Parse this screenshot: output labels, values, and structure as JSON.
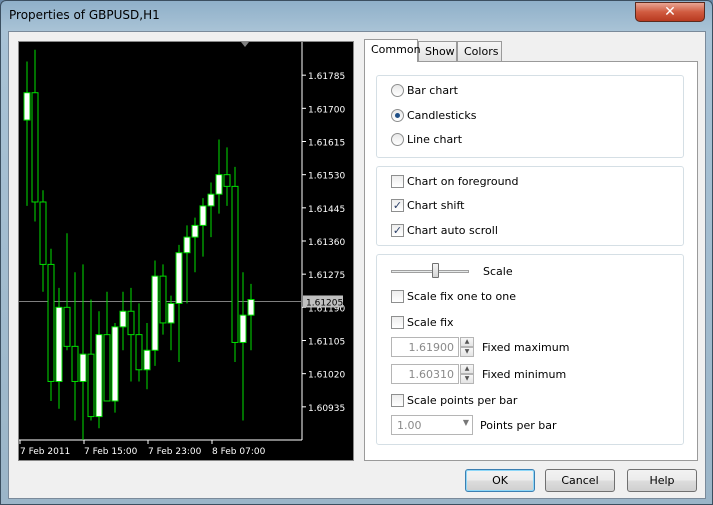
{
  "window": {
    "title": "Properties of GBPUSD,H1",
    "close_glyph": "✕"
  },
  "chart": {
    "price_labels": [
      "1.61785",
      "1.61700",
      "1.61615",
      "1.61530",
      "1.61445",
      "1.61360",
      "1.61275",
      "1.61190",
      "1.61105",
      "1.61020",
      "1.60935"
    ],
    "current_price": "1.61205",
    "time_labels": [
      "7 Feb 2011",
      "7 Feb 15:00",
      "7 Feb 23:00",
      "8 Feb 07:00"
    ],
    "candles": [
      {
        "o": 1.6167,
        "h": 1.6182,
        "l": 1.6145,
        "c": 1.6174
      },
      {
        "o": 1.6174,
        "h": 1.6185,
        "l": 1.6141,
        "c": 1.6146
      },
      {
        "o": 1.6146,
        "h": 1.6149,
        "l": 1.6123,
        "c": 1.613
      },
      {
        "o": 1.613,
        "h": 1.6134,
        "l": 1.6095,
        "c": 1.61
      },
      {
        "o": 1.61,
        "h": 1.6124,
        "l": 1.6093,
        "c": 1.6119
      },
      {
        "o": 1.6119,
        "h": 1.6138,
        "l": 1.6108,
        "c": 1.6109
      },
      {
        "o": 1.6109,
        "h": 1.6128,
        "l": 1.609,
        "c": 1.61
      },
      {
        "o": 1.61,
        "h": 1.613,
        "l": 1.6085,
        "c": 1.6107
      },
      {
        "o": 1.6107,
        "h": 1.6121,
        "l": 1.609,
        "c": 1.6091
      },
      {
        "o": 1.6091,
        "h": 1.6118,
        "l": 1.6088,
        "c": 1.6112
      },
      {
        "o": 1.6112,
        "h": 1.6123,
        "l": 1.6096,
        "c": 1.6095
      },
      {
        "o": 1.6095,
        "h": 1.6115,
        "l": 1.6092,
        "c": 1.6114
      },
      {
        "o": 1.6114,
        "h": 1.6123,
        "l": 1.6108,
        "c": 1.6118
      },
      {
        "o": 1.6118,
        "h": 1.6124,
        "l": 1.61,
        "c": 1.6112
      },
      {
        "o": 1.6112,
        "h": 1.612,
        "l": 1.61,
        "c": 1.6103
      },
      {
        "o": 1.6103,
        "h": 1.6115,
        "l": 1.6098,
        "c": 1.6108
      },
      {
        "o": 1.6108,
        "h": 1.6131,
        "l": 1.6104,
        "c": 1.6127
      },
      {
        "o": 1.6127,
        "h": 1.613,
        "l": 1.6112,
        "c": 1.6115
      },
      {
        "o": 1.6115,
        "h": 1.6122,
        "l": 1.6108,
        "c": 1.612
      },
      {
        "o": 1.612,
        "h": 1.6135,
        "l": 1.6105,
        "c": 1.6133
      },
      {
        "o": 1.6133,
        "h": 1.614,
        "l": 1.612,
        "c": 1.6137
      },
      {
        "o": 1.6137,
        "h": 1.6142,
        "l": 1.6128,
        "c": 1.614
      },
      {
        "o": 1.614,
        "h": 1.6147,
        "l": 1.6132,
        "c": 1.6145
      },
      {
        "o": 1.6145,
        "h": 1.6151,
        "l": 1.6137,
        "c": 1.6148
      },
      {
        "o": 1.6148,
        "h": 1.6162,
        "l": 1.6143,
        "c": 1.6153
      },
      {
        "o": 1.6153,
        "h": 1.616,
        "l": 1.6145,
        "c": 1.615
      },
      {
        "o": 1.615,
        "h": 1.6155,
        "l": 1.6105,
        "c": 1.611
      },
      {
        "o": 1.611,
        "h": 1.6128,
        "l": 1.609,
        "c": 1.6117
      },
      {
        "o": 1.6117,
        "h": 1.6125,
        "l": 1.6108,
        "c": 1.6121
      }
    ]
  },
  "tabs": [
    {
      "label": "Common",
      "active": true
    },
    {
      "label": "Show",
      "active": false
    },
    {
      "label": "Colors",
      "active": false
    }
  ],
  "chart_type": {
    "bar": "Bar chart",
    "candles": "Candlesticks",
    "line": "Line chart",
    "selected": "candles"
  },
  "options": {
    "foreground": {
      "label": "Chart on foreground",
      "checked": false
    },
    "shift": {
      "label": "Chart shift",
      "checked": true
    },
    "autoscroll": {
      "label": "Chart auto scroll",
      "checked": true
    }
  },
  "scale": {
    "label": "Scale",
    "level": 0.55,
    "fix_one": {
      "label": "Scale fix one to one",
      "checked": false
    },
    "fix": {
      "label": "Scale fix",
      "checked": false
    },
    "fixed_max": {
      "value": "1.61900",
      "label": "Fixed maximum"
    },
    "fixed_min": {
      "value": "1.60310",
      "label": "Fixed minimum"
    },
    "points_per_bar": {
      "label": "Scale points per bar",
      "checked": false
    },
    "ppb_value": {
      "value": "1.00",
      "label": "Points per bar"
    }
  },
  "buttons": {
    "ok": "OK",
    "cancel": "Cancel",
    "help": "Help"
  },
  "colors": {
    "chart_bg": "#000000",
    "candle_line": "#00e000",
    "bull_body": "#ffffff",
    "bear_body": "#000000",
    "grid": "#555555",
    "axis_text": "#ffffff"
  }
}
